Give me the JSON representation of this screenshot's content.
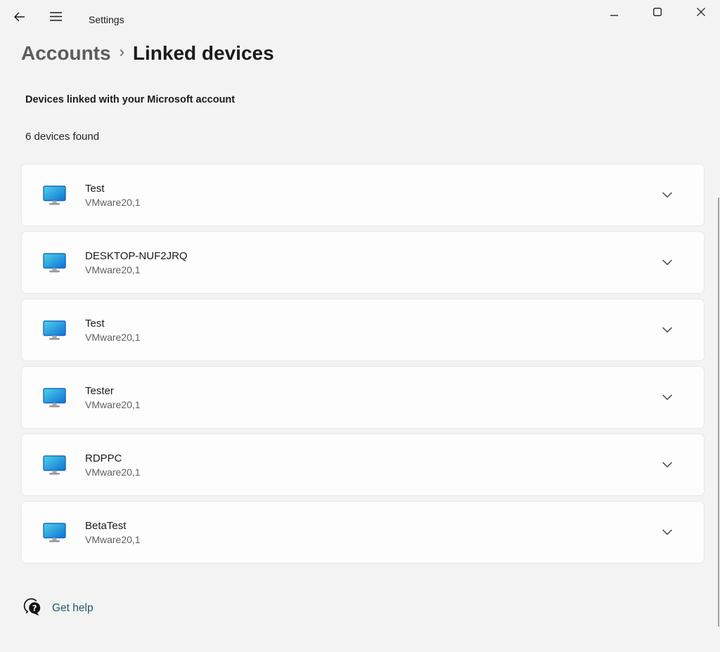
{
  "window": {
    "title": "Settings"
  },
  "breadcrumb": {
    "parent": "Accounts",
    "separator": "›",
    "current": "Linked devices"
  },
  "page": {
    "section_heading": "Devices linked with your Microsoft account",
    "result_count": "6 devices found",
    "devices": [
      {
        "name": "Test",
        "model": "VMware20,1"
      },
      {
        "name": "DESKTOP-NUF2JRQ",
        "model": "VMware20,1"
      },
      {
        "name": "Test",
        "model": "VMware20,1"
      },
      {
        "name": "Tester",
        "model": "VMware20,1"
      },
      {
        "name": "RDPPC",
        "model": "VMware20,1"
      },
      {
        "name": "BetaTest",
        "model": "VMware20,1"
      }
    ]
  },
  "footer": {
    "get_help_label": "Get help"
  },
  "icons": {
    "back": "back-arrow-icon",
    "menu": "hamburger-menu-icon",
    "minimize": "minimize-icon",
    "maximize": "maximize-icon",
    "close": "close-icon",
    "device": "monitor-icon",
    "expand": "chevron-down-icon",
    "help": "help-bubble-icon"
  },
  "colors": {
    "page_background": "#f3f3f3",
    "card_background": "#fdfdfd",
    "card_border": "#e7e7e7",
    "primary_text": "#1a1a1a",
    "muted_text": "#5c5c5c",
    "link_text": "#215a6f",
    "monitor_gradient_start": "#4fd4e6",
    "monitor_gradient_end": "#0f6fd7",
    "scrollbar": "#a0a0a0"
  }
}
